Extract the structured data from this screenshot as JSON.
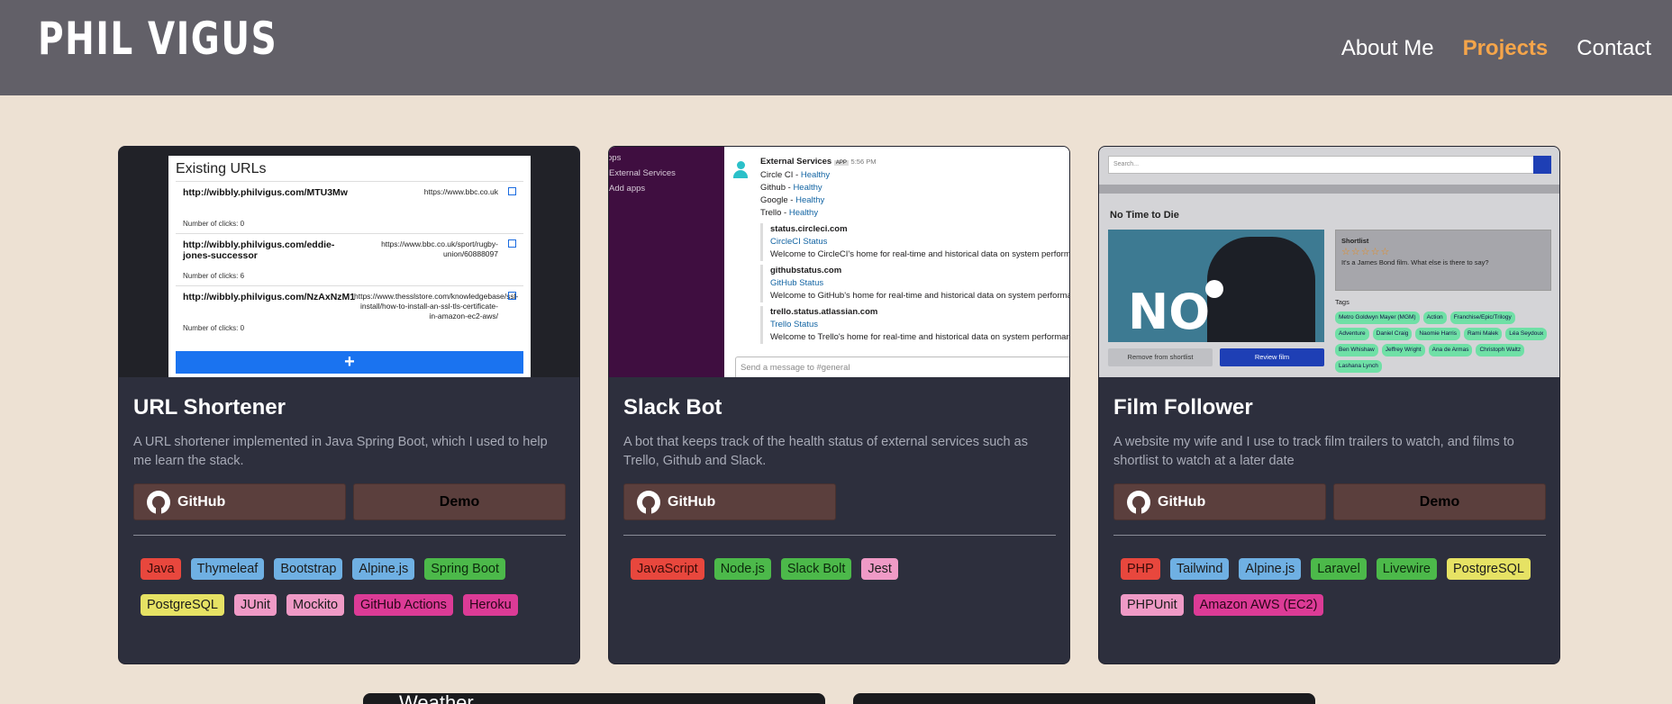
{
  "header": {
    "logo": "PHIL VIGUS",
    "nav": [
      {
        "label": "About Me"
      },
      {
        "label": "Projects"
      },
      {
        "label": "Contact"
      }
    ]
  },
  "projects": [
    {
      "title": "URL Shortener",
      "description": "A URL shortener implemented in Java Spring Boot, which I used to help me learn the stack.",
      "github_label": "GitHub",
      "demo_label": "Demo",
      "tags": [
        "Java",
        "Thymeleaf",
        "Bootstrap",
        "Alpine.js",
        "Spring Boot",
        "PostgreSQL",
        "JUnit",
        "Mockito",
        "GitHub Actions",
        "Heroku"
      ],
      "screenshot": {
        "title": "Existing URLs",
        "rows": [
          {
            "short": "http://wibbly.philvigus.com/MTU3Mw",
            "long": "https://www.bbc.co.uk",
            "clicks": "Number of clicks: 0"
          },
          {
            "short": "http://wibbly.philvigus.com/eddie-jones-successor",
            "long": "https://www.bbc.co.uk/sport/rugby-union/60888097",
            "clicks": "Number of clicks: 6"
          },
          {
            "short": "http://wibbly.philvigus.com/NzAxNzM1",
            "long": "https://www.thesslstore.com/knowledgebase/ssl-install/how-to-install-an-ssl-tls-certificate-in-amazon-ec2-aws/",
            "clicks": "Number of clicks: 0"
          }
        ],
        "add": "+"
      }
    },
    {
      "title": "Slack Bot",
      "description": "A bot that keeps track of the health status of external services such as Trello, Github and Slack.",
      "github_label": "GitHub",
      "tags": [
        "JavaScript",
        "Node.js",
        "Slack Bolt",
        "Jest"
      ],
      "screenshot": {
        "sidebar": [
          "pps",
          "External Services",
          "Add apps"
        ],
        "sender": "External Services",
        "app_badge": "APP",
        "time": "5:56 PM",
        "statuses": [
          {
            "service": "Circle CI -",
            "status": "Healthy"
          },
          {
            "service": "Github -",
            "status": "Healthy"
          },
          {
            "service": "Google -",
            "status": "Healthy"
          },
          {
            "service": "Trello -",
            "status": "Healthy"
          }
        ],
        "attachments": [
          {
            "site": "status.circleci.com",
            "link": "CircleCI Status",
            "text": "Welcome to CircleCI's home for real-time and historical data on system performan"
          },
          {
            "site": "githubstatus.com",
            "link": "GitHub Status",
            "text": "Welcome to GitHub's home for real-time and historical data on system performanc"
          },
          {
            "site": "trello.status.atlassian.com",
            "link": "Trello Status",
            "text": "Welcome to Trello's home for real-time and historical data on system performance"
          }
        ],
        "compose_placeholder": "Send a message to #general"
      }
    },
    {
      "title": "Film Follower",
      "description": "A website my wife and I use to track film trailers to watch, and films to shortlist to watch at a later date",
      "github_label": "GitHub",
      "demo_label": "Demo",
      "tags": [
        "PHP",
        "Tailwind",
        "Alpine.js",
        "Laravel",
        "Livewire",
        "PostgreSQL",
        "PHPUnit",
        "Amazon AWS (EC2)"
      ],
      "screenshot": {
        "search_placeholder": "Search...",
        "film_title": "No Time to Die",
        "poster_text": "NO",
        "shortlist_label": "Shortlist",
        "stars": "☆☆☆☆☆",
        "note": "It's a James Bond film. What else is there to say?",
        "tags_label": "Tags",
        "film_tags": [
          "Metro Goldwyn Mayer (MGM)",
          "Action",
          "Franchise/Epic/Trilogy",
          "Adventure",
          "Daniel Craig",
          "Naomie Harris",
          "Rami Malek",
          "Léa Seydoux",
          "Ben Whishaw",
          "Jeffrey Wright",
          "Ana de Armas",
          "Christoph Waltz",
          "Lashana Lynch"
        ],
        "remove_label": "Remove from shortlist",
        "review_label": "Review film"
      }
    }
  ],
  "bottom_cards": [
    {
      "title": "Weather"
    },
    {
      "title": ""
    }
  ],
  "colors": {
    "header_bg": "#626068",
    "page_bg": "#ede1d3",
    "card_bg": "#2d2f3d",
    "nav_active": "#f5a54a",
    "button_bg": "#5b3f3d"
  }
}
